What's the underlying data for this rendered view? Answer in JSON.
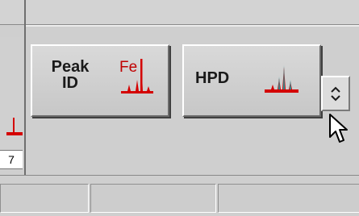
{
  "left_panel": {
    "sliver_label": "7"
  },
  "buttons": {
    "peak_id": {
      "label_line1": "Peak",
      "label_line2": "ID",
      "icon": "fe-spectrum-icon",
      "icon_text": "Fe"
    },
    "hpd": {
      "label": "HPD",
      "icon": "spectrum-peaks-icon"
    },
    "spinner": {
      "icon": "up-down-chevron-icon"
    }
  },
  "colors": {
    "accent_red": "#d40000",
    "peak_teal": "#1f9aa0",
    "panel_bg": "#cfcfcf"
  },
  "status_bar": {
    "segments": [
      "",
      "",
      ""
    ]
  }
}
